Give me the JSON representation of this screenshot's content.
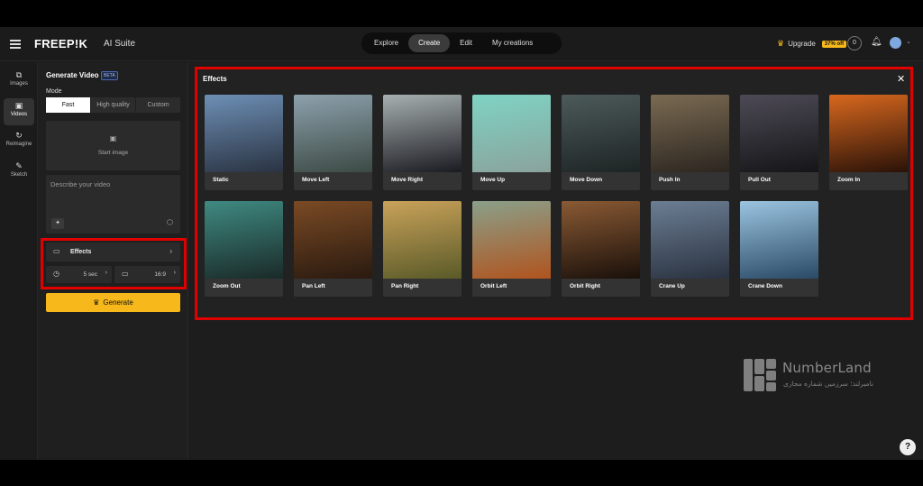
{
  "topbar": {
    "logo": "FREEP!K",
    "suite": "AI Suite",
    "tabs": [
      "Explore",
      "Create",
      "Edit",
      "My creations"
    ],
    "active_tab": "Create",
    "upgrade": "Upgrade",
    "discount": "37% off",
    "credits": "0"
  },
  "rail": [
    {
      "label": "Images",
      "icon": "image-icon",
      "glyph": "⧉"
    },
    {
      "label": "Videos",
      "icon": "video-icon",
      "glyph": "▣"
    },
    {
      "label": "Reimagine",
      "icon": "refresh-icon",
      "glyph": "↻"
    },
    {
      "label": "Sketch",
      "icon": "pen-icon",
      "glyph": "✎"
    }
  ],
  "panel": {
    "title": "Generate Video",
    "beta": "BETA",
    "mode_label": "Mode",
    "modes": [
      "Fast",
      "High quality",
      "Custom"
    ],
    "start_image": "Start image",
    "prompt_placeholder": "Describe your video",
    "effects_label": "Effects",
    "duration": "5 sec",
    "aspect_ratio": "16:9",
    "generate": "Generate"
  },
  "effects": {
    "title": "Effects",
    "items": [
      {
        "label": "Static",
        "c1": "#6d8fb5",
        "c2": "#2a3342"
      },
      {
        "label": "Move Left",
        "c1": "#8da1ad",
        "c2": "#3c4a44"
      },
      {
        "label": "Move Right",
        "c1": "#a7b0b0",
        "c2": "#1b1b22"
      },
      {
        "label": "Move Up",
        "c1": "#7fd3c4",
        "c2": "#8aa39c"
      },
      {
        "label": "Move Down",
        "c1": "#4d5a5a",
        "c2": "#1d2424"
      },
      {
        "label": "Push In",
        "c1": "#7a6a52",
        "c2": "#2c2620"
      },
      {
        "label": "Pull Out",
        "c1": "#4d4a55",
        "c2": "#151518"
      },
      {
        "label": "Zoom In",
        "c1": "#d8681e",
        "c2": "#2a1208"
      },
      {
        "label": "Zoom Out",
        "c1": "#3f8a82",
        "c2": "#1a2a28"
      },
      {
        "label": "Pan Left",
        "c1": "#7a4a24",
        "c2": "#2a1a10"
      },
      {
        "label": "Pan Right",
        "c1": "#c9a25a",
        "c2": "#5a5a28"
      },
      {
        "label": "Orbit Left",
        "c1": "#8aa08a",
        "c2": "#b0541e"
      },
      {
        "label": "Orbit Right",
        "c1": "#8a5a34",
        "c2": "#1a100a"
      },
      {
        "label": "Crane Up",
        "c1": "#6c7e94",
        "c2": "#2a3240"
      },
      {
        "label": "Crane Down",
        "c1": "#9bc4e0",
        "c2": "#2a4a66"
      }
    ]
  },
  "watermark": {
    "title": "NumberLand",
    "subtitle": "نامبرلند؛ سرزمین شماره مجازی"
  },
  "help": "?"
}
